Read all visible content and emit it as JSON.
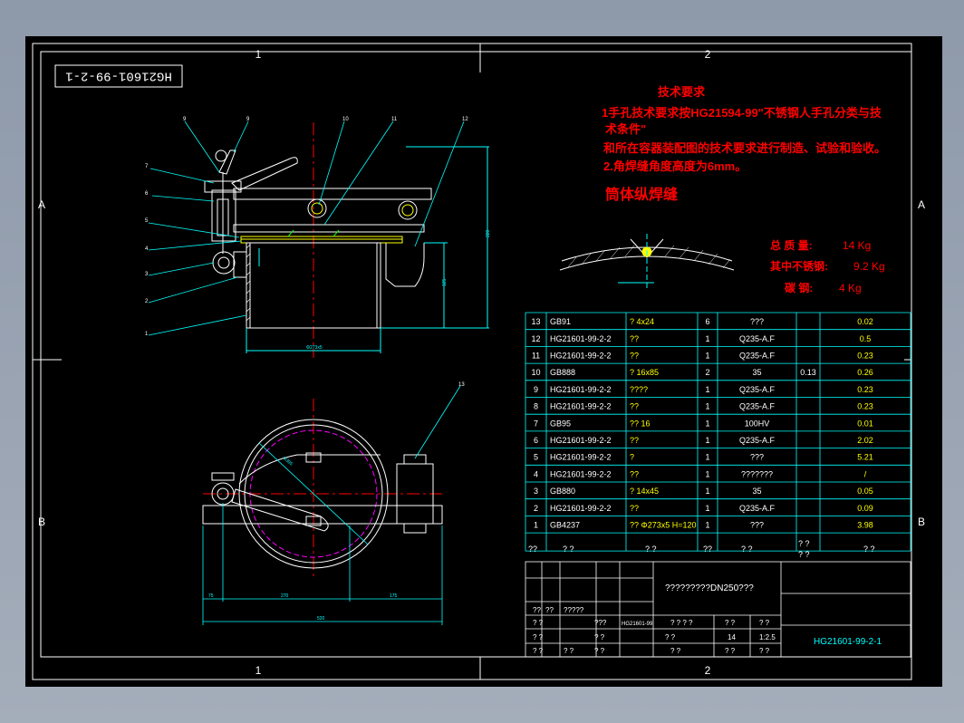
{
  "frame": {
    "zone_top": [
      "1",
      "2"
    ],
    "zone_bottom": [
      "1",
      "2"
    ],
    "zone_left": [
      "A",
      "B"
    ],
    "zone_right": [
      "A",
      "B"
    ]
  },
  "stamp": "HG21601-99-2-1",
  "notes": {
    "heading": "技术要求",
    "line1": "1手孔技术要求按HG21594-99\"不锈钢人手孔分类与技",
    "line2": "术条件\"",
    "line3": "和所在容器装配图的技术要求进行制造、试验和验收。",
    "line4": "2.角焊缝角度高度为6mm。",
    "weld_title": "筒体纵焊缝"
  },
  "mass": {
    "total_label": "总 质 量:",
    "total_value": "14 Kg",
    "ss_label": "其中不锈钢:",
    "ss_value": "9.2 Kg",
    "cs_label": "碳 钢:",
    "cs_value": "4 Kg"
  },
  "bom": [
    {
      "no": "13",
      "code": "GB91",
      "name": "?  4x24",
      "qty": "6",
      "mat": "???",
      "unit": "",
      "total": "0.02"
    },
    {
      "no": "12",
      "code": "HG21601-99-2-2",
      "name": "??",
      "qty": "1",
      "mat": "Q235-A.F",
      "unit": "",
      "total": "0.5"
    },
    {
      "no": "11",
      "code": "HG21601-99-2-2",
      "name": "??",
      "qty": "1",
      "mat": "Q235-A.F",
      "unit": "",
      "total": "0.23"
    },
    {
      "no": "10",
      "code": "GB888",
      "name": "? 16x85",
      "qty": "2",
      "mat": "35",
      "unit": "0.13",
      "total": "0.26"
    },
    {
      "no": "9",
      "code": "HG21601-99-2-2",
      "name": "????",
      "qty": "1",
      "mat": "Q235-A.F",
      "unit": "",
      "total": "0.23"
    },
    {
      "no": "8",
      "code": "HG21601-99-2-2",
      "name": "??",
      "qty": "1",
      "mat": "Q235-A.F",
      "unit": "",
      "total": "0.23"
    },
    {
      "no": "7",
      "code": "GB95",
      "name": "?? 16",
      "qty": "1",
      "mat": "100HV",
      "unit": "",
      "total": "0.01"
    },
    {
      "no": "6",
      "code": "HG21601-99-2-2",
      "name": "??",
      "qty": "1",
      "mat": "Q235-A.F",
      "unit": "",
      "total": "2.02"
    },
    {
      "no": "5",
      "code": "HG21601-99-2-2",
      "name": "?",
      "qty": "1",
      "mat": "???",
      "unit": "",
      "total": "5.21"
    },
    {
      "no": "4",
      "code": "HG21601-99-2-2",
      "name": "??",
      "qty": "1",
      "mat": "???????",
      "unit": "",
      "total": "/"
    },
    {
      "no": "3",
      "code": "GB880",
      "name": "?  14x45",
      "qty": "1",
      "mat": "35",
      "unit": "",
      "total": "0.05"
    },
    {
      "no": "2",
      "code": "HG21601-99-2-2",
      "name": "??",
      "qty": "1",
      "mat": "Q235-A.F",
      "unit": "",
      "total": "0.09"
    },
    {
      "no": "1",
      "code": "GB4237",
      "name": "?? Φ273x5 H=120",
      "qty": "1",
      "mat": "???",
      "unit": "",
      "total": "3.98"
    }
  ],
  "bom_header": {
    "no": "??",
    "code": "?  ?",
    "name": "?  ?",
    "qty": "??",
    "mat": "?  ?",
    "unit": "? ?",
    "unit_sub": "?  ?",
    "total": "?  ?"
  },
  "title_block": {
    "title": "?????????DN250???",
    "drawing_no": "HG21601-99-2-1",
    "scale": "1:2.5",
    "mass": "14",
    "r1": [
      "??",
      "??",
      "?????"
    ],
    "r2": [
      "? ?",
      "???",
      "HG21601-99",
      "? ? ? ?",
      "? ?",
      "? ?"
    ],
    "r3": [
      "? ?",
      "? ?",
      "? ?"
    ],
    "r4": [
      "? ?",
      "? ?",
      "? ?",
      "? ?",
      "? ?",
      "? ?"
    ]
  },
  "balloons_top": [
    "9",
    "9",
    "7",
    "6",
    "5",
    "4",
    "3",
    "2",
    "1",
    "10",
    "11",
    "12"
  ],
  "balloons_bottom": [
    "13"
  ],
  "dims": {
    "top_width": "Φ273x5",
    "top_h1": "220",
    "top_h2": "125",
    "plan_d": "Φ395",
    "plan_w1": "75",
    "plan_w2": "270",
    "plan_w3": "175",
    "plan_total": "520"
  },
  "colors": {
    "line": "#ffffff",
    "cyan": "#00ffff",
    "red": "#ff0000",
    "yellow": "#ffff00",
    "magenta": "#ff00ff",
    "green": "#00ff00"
  }
}
